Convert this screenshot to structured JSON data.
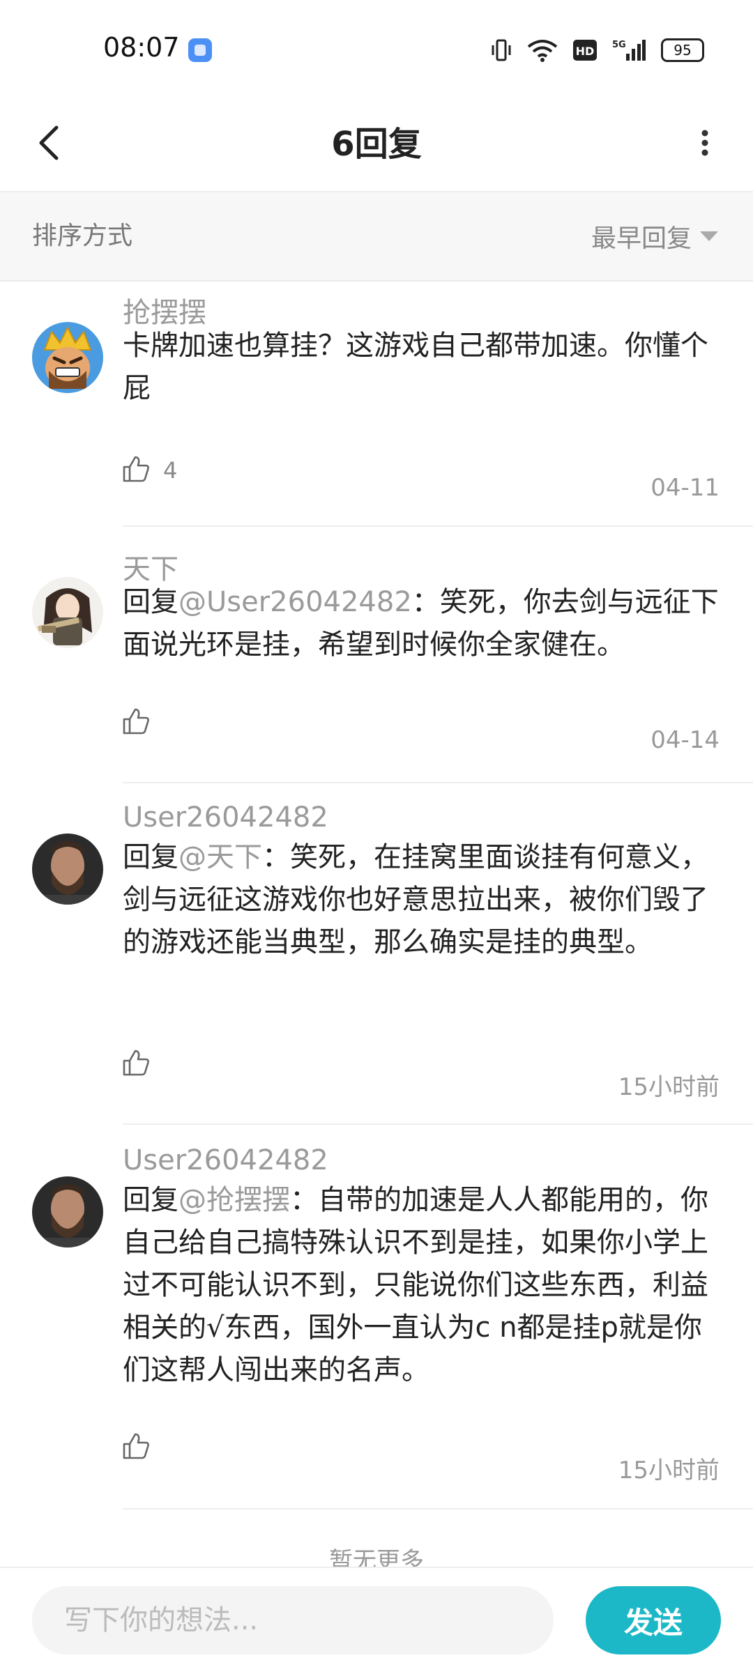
{
  "status_bar": {
    "time": "08:07",
    "battery": "95",
    "icons": [
      "vibrate-icon",
      "wifi-icon",
      "hd-icon",
      "5g-signal-icon",
      "battery-icon"
    ]
  },
  "header": {
    "title": "6回复",
    "back_icon": "chevron-left-icon",
    "more_icon": "more-vertical-icon"
  },
  "sort": {
    "label": "排序方式",
    "selected": "最早回复"
  },
  "comments": [
    {
      "name": "抢摆摆",
      "reply_prefix": "",
      "mention": "",
      "text": "卡牌加速也算挂？这游戏自己都带加速。你懂个屁",
      "likes": "4",
      "time": "04-11",
      "avatar": "clash-king-avatar"
    },
    {
      "name": "天下",
      "reply_prefix": "回复",
      "mention": "@User26042482",
      "text": "：笑死，你去剑与远征下面说光环是挂，希望到时候你全家健在。",
      "likes": "",
      "time": "04-14",
      "avatar": "anime-girl-avatar"
    },
    {
      "name": "User26042482",
      "reply_prefix": "回复",
      "mention": "@天下",
      "text": "：笑死，在挂窝里面谈挂有何意义，剑与远征这游戏你也好意思拉出来，被你们毁了的游戏还能当典型，那么确实是挂的典型。",
      "likes": "",
      "time": "15小时前",
      "avatar": "bearded-man-avatar"
    },
    {
      "name": "User26042482",
      "reply_prefix": "回复",
      "mention": "@抢摆摆",
      "text": "：自带的加速是人人都能用的，你自己给自己搞特殊认识不到是挂，如果你小学上过不可能认识不到，只能说你们这些东西，利益相关的√东西，国外一直认为c n都是挂p就是你们这帮人闯出来的名声。",
      "likes": "",
      "time": "15小时前",
      "avatar": "bearded-man-avatar"
    }
  ],
  "footer": {
    "no_more": "暂无更多",
    "input_placeholder": "写下你的想法...",
    "send_label": "发送"
  },
  "colors": {
    "accent": "#1db8c8",
    "muted_text": "#9a9a9a",
    "status_icon_bg": "#4c8ff5"
  }
}
